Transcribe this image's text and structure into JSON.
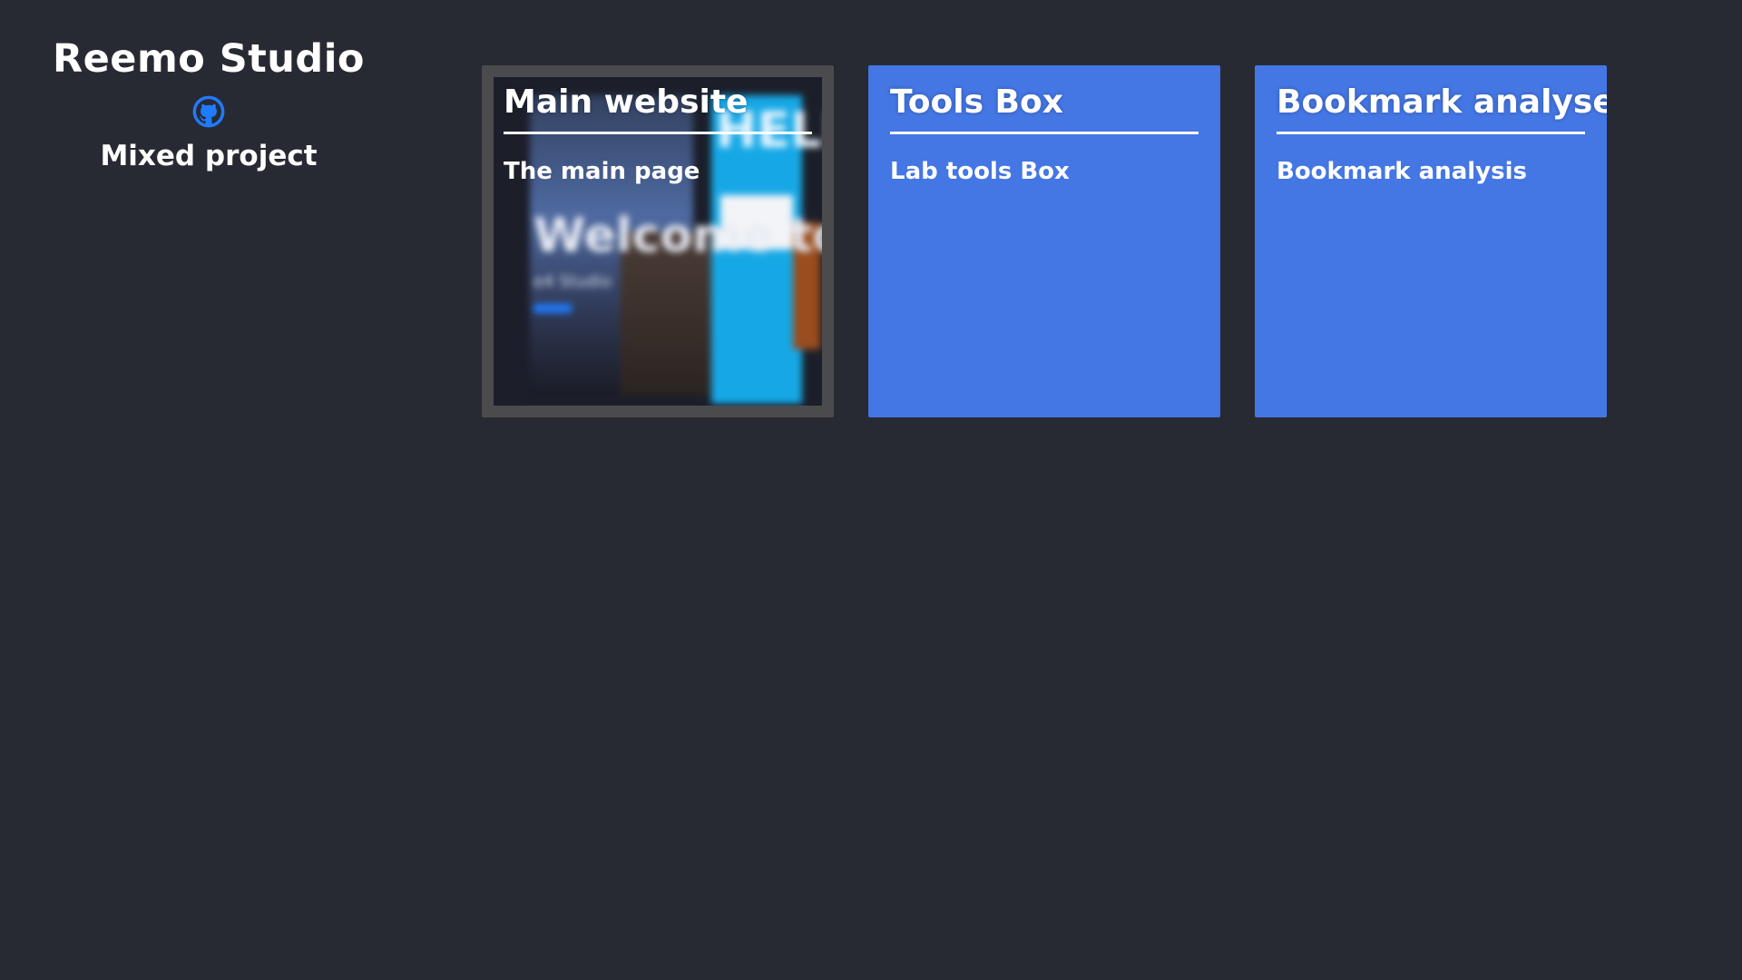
{
  "header": {
    "title": "Reemo Studio",
    "github_icon": "github-icon",
    "subtitle": "Mixed project"
  },
  "colors": {
    "background": "#282a33",
    "card_blue": "#4476e4",
    "card_preview_frame": "#4b4b4e",
    "github_blue": "#1f7bff"
  },
  "cards": [
    {
      "title": "Main website",
      "description": "The main page",
      "preview": {
        "welcome": "Welcome to",
        "sub": "e4 Studio",
        "hello": "HELLO"
      }
    },
    {
      "title": "Tools Box",
      "description": "Lab tools Box"
    },
    {
      "title": "Bookmark analyser",
      "description": "Bookmark analysis"
    }
  ]
}
